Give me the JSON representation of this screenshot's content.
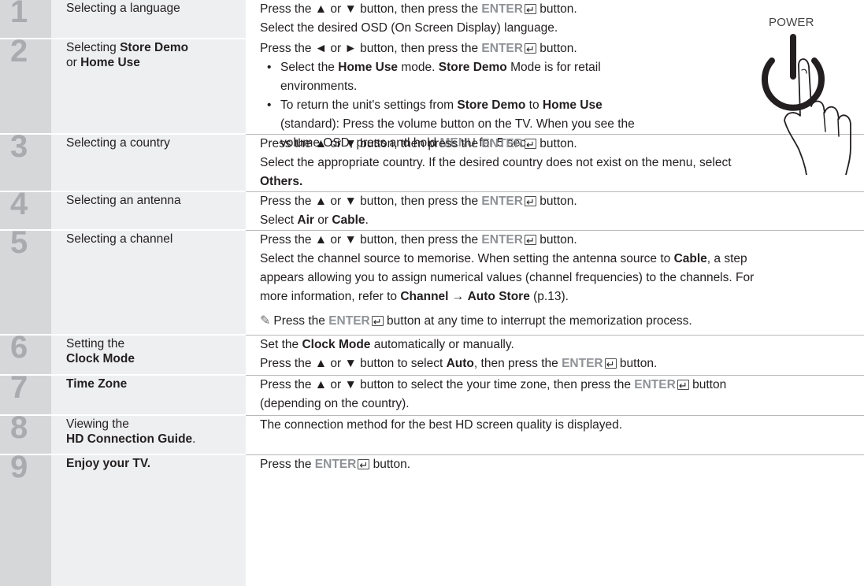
{
  "power_label": "POWER",
  "steps": [
    {
      "num": "1",
      "label": "Selecting a language",
      "line1": {
        "a": "Press the ▲ or ▼ button, then press the ",
        "key": "ENTER",
        "b": " button."
      },
      "line2": "Select the desired OSD (On Screen Display) language."
    },
    {
      "num": "2",
      "label_a": "Selecting ",
      "label_b": "Store Demo",
      "label_c": "or ",
      "label_d": "Home Use",
      "line1": {
        "a": "Press the ◄ or ► button, then press the ",
        "key": "ENTER",
        "b": " button."
      },
      "bullet1": {
        "a": "Select the ",
        "b": "Home Use",
        "c": " mode. ",
        "d": "Store Demo",
        "e": " Mode is for retail",
        "f": "environments."
      },
      "bullet2": {
        "a": "To return the unit's settings from ",
        "b": "Store Demo",
        "c": " to ",
        "d": "Home Use",
        "e": "(standard): Press the volume button on the TV. When you see the",
        "f": "volume OSD, press and hold ",
        "g": "MENU",
        "h": " for 5 sec."
      }
    },
    {
      "num": "3",
      "label": "Selecting a country",
      "line1": {
        "a": "Press the ▲ or ▼ button, then press the ",
        "key": "ENTER",
        "b": " button."
      },
      "line2": "Select the appropriate country. If the desired country does not exist on the menu, select",
      "line3": "Others."
    },
    {
      "num": "4",
      "label": "Selecting an antenna",
      "line1": {
        "a": "Press the ▲ or ▼ button, then press the ",
        "key": "ENTER",
        "b": " button."
      },
      "line2a": "Select ",
      "line2b": "Air",
      "line2c": " or ",
      "line2d": "Cable",
      "line2e": "."
    },
    {
      "num": "5",
      "label": "Selecting a channel",
      "line1": {
        "a": "Press the ▲ or ▼ button, then press the ",
        "key": "ENTER",
        "b": " button."
      },
      "line2a": "Select the channel source to memorise. When setting the antenna source to ",
      "line2b": "Cable",
      "line2c": ", a step",
      "line3": "appears allowing you to assign numerical values (channel frequencies) to the channels. For",
      "line4a": "more information, refer to ",
      "line4b": "Channel",
      "line4c": " → ",
      "line4d": "Auto Store",
      "line4e": " (p.13).",
      "note": {
        "a": "Press the ",
        "key": "ENTER",
        "b": " button at any time to interrupt the memorization process."
      }
    },
    {
      "num": "6",
      "label_a": "Setting the",
      "label_b": "Clock Mode",
      "line1a": "Set the ",
      "line1b": "Clock Mode",
      "line1c": " automatically or manually.",
      "line2": {
        "a": "Press the ▲ or ▼ button to select ",
        "bold": "Auto",
        "c": ", then press the ",
        "key": "ENTER",
        "b": " button."
      }
    },
    {
      "num": "7",
      "label": "Time Zone",
      "line1": {
        "a": "Press the ▲ or ▼ button to select the your time zone, then press the ",
        "key": "ENTER",
        "b": " button"
      },
      "line2": "(depending on the country)."
    },
    {
      "num": "8",
      "label_a": "Viewing the",
      "label_b": "HD Connection Guide",
      "label_c": ".",
      "line1": "The connection method for the best HD screen quality is displayed."
    },
    {
      "num": "9",
      "label": "Enjoy your TV.",
      "line1": {
        "a": "Press the ",
        "key": "ENTER",
        "b": " button."
      }
    }
  ]
}
